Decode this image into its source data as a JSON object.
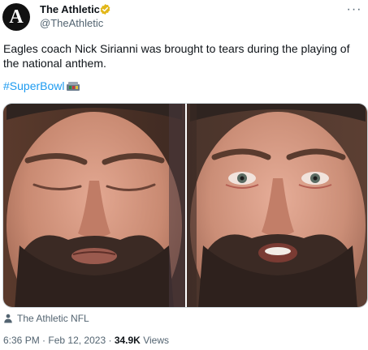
{
  "author": {
    "name": "The Athletic",
    "handle": "@TheAthletic",
    "avatar_letter": "A",
    "verified_badge_color": "#e2b719"
  },
  "tweet": {
    "text": "Eagles coach Nick Sirianni was brought to tears during the playing of the national anthem.",
    "hashtag": "#SuperBowl",
    "hashtag_color": "#1d9bf0"
  },
  "media": {
    "images": [
      {
        "name": "sirianni-eyes-closed"
      },
      {
        "name": "sirianni-eyes-open-tearful"
      }
    ]
  },
  "tag": {
    "label": "The Athletic NFL"
  },
  "meta": {
    "time": "6:36 PM",
    "date": "Feb 12, 2023",
    "separator": "·",
    "views_count": "34.9K",
    "views_label": "Views"
  },
  "icons": {
    "more": "more-options-icon",
    "verified": "verified-badge-icon",
    "person": "person-icon",
    "hashflag": "super-bowl-hashflag-icon"
  }
}
